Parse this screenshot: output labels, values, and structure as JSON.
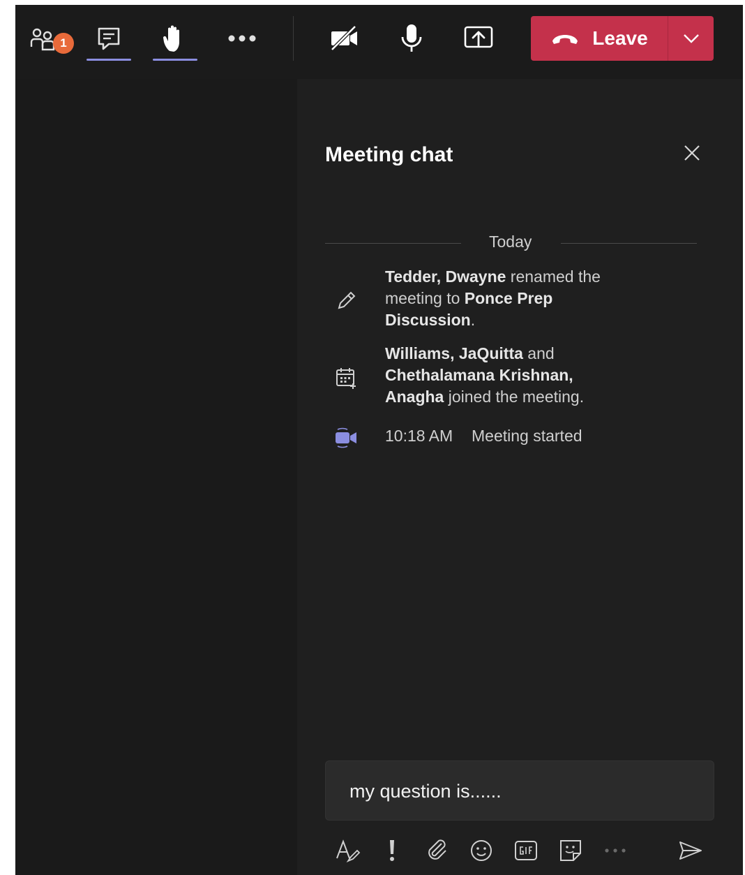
{
  "toolbar": {
    "participants_badge": "1",
    "leave_label": "Leave",
    "accent_underline": "#8b8ee0",
    "leave_color": "#c4314b"
  },
  "chat": {
    "title": "Meeting chat",
    "date_divider": "Today",
    "events": [
      {
        "icon": "pencil-icon",
        "parts": [
          "Tedder, Dwayne",
          " renamed the meeting to ",
          "Ponce Prep Discussion",
          "."
        ]
      },
      {
        "icon": "calendar-add-icon",
        "parts": [
          "Williams, JaQuitta",
          " and ",
          "Chethalamana Krishnan, Anagha",
          " joined the meeting."
        ]
      },
      {
        "icon": "video-call-icon",
        "time": "10:18 AM",
        "text": "Meeting started"
      }
    ],
    "composer_value": "my question is......"
  }
}
